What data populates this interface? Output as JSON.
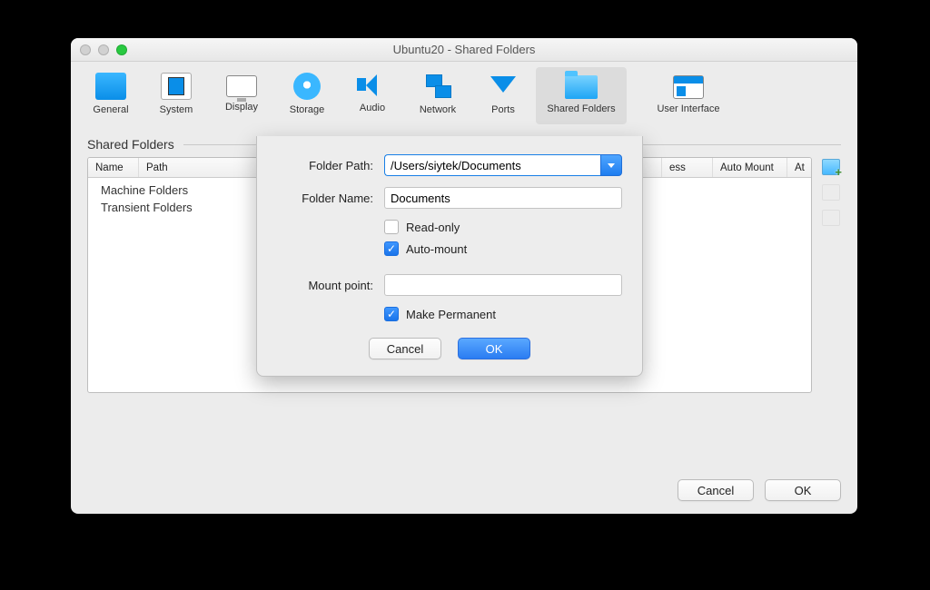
{
  "window": {
    "title": "Ubuntu20 - Shared Folders"
  },
  "toolbar": {
    "items": [
      {
        "label": "General"
      },
      {
        "label": "System"
      },
      {
        "label": "Display"
      },
      {
        "label": "Storage"
      },
      {
        "label": "Audio"
      },
      {
        "label": "Network"
      },
      {
        "label": "Ports"
      },
      {
        "label": "Shared Folders"
      },
      {
        "label": "User Interface"
      }
    ]
  },
  "section": {
    "title": "Shared Folders"
  },
  "table": {
    "columns": {
      "name": "Name",
      "path": "Path",
      "access": "ess",
      "automount": "Auto Mount",
      "at": "At"
    },
    "categories": [
      "Machine Folders",
      "Transient Folders"
    ]
  },
  "sheet": {
    "labels": {
      "folder_path": "Folder Path:",
      "folder_name": "Folder Name:",
      "mount_point": "Mount point:",
      "read_only": "Read-only",
      "auto_mount": "Auto-mount",
      "make_permanent": "Make Permanent"
    },
    "values": {
      "folder_path": "/Users/siytek/Documents",
      "folder_name": "Documents",
      "mount_point": ""
    },
    "checks": {
      "read_only": false,
      "auto_mount": true,
      "make_permanent": true
    },
    "buttons": {
      "cancel": "Cancel",
      "ok": "OK"
    }
  },
  "footer": {
    "cancel": "Cancel",
    "ok": "OK"
  }
}
